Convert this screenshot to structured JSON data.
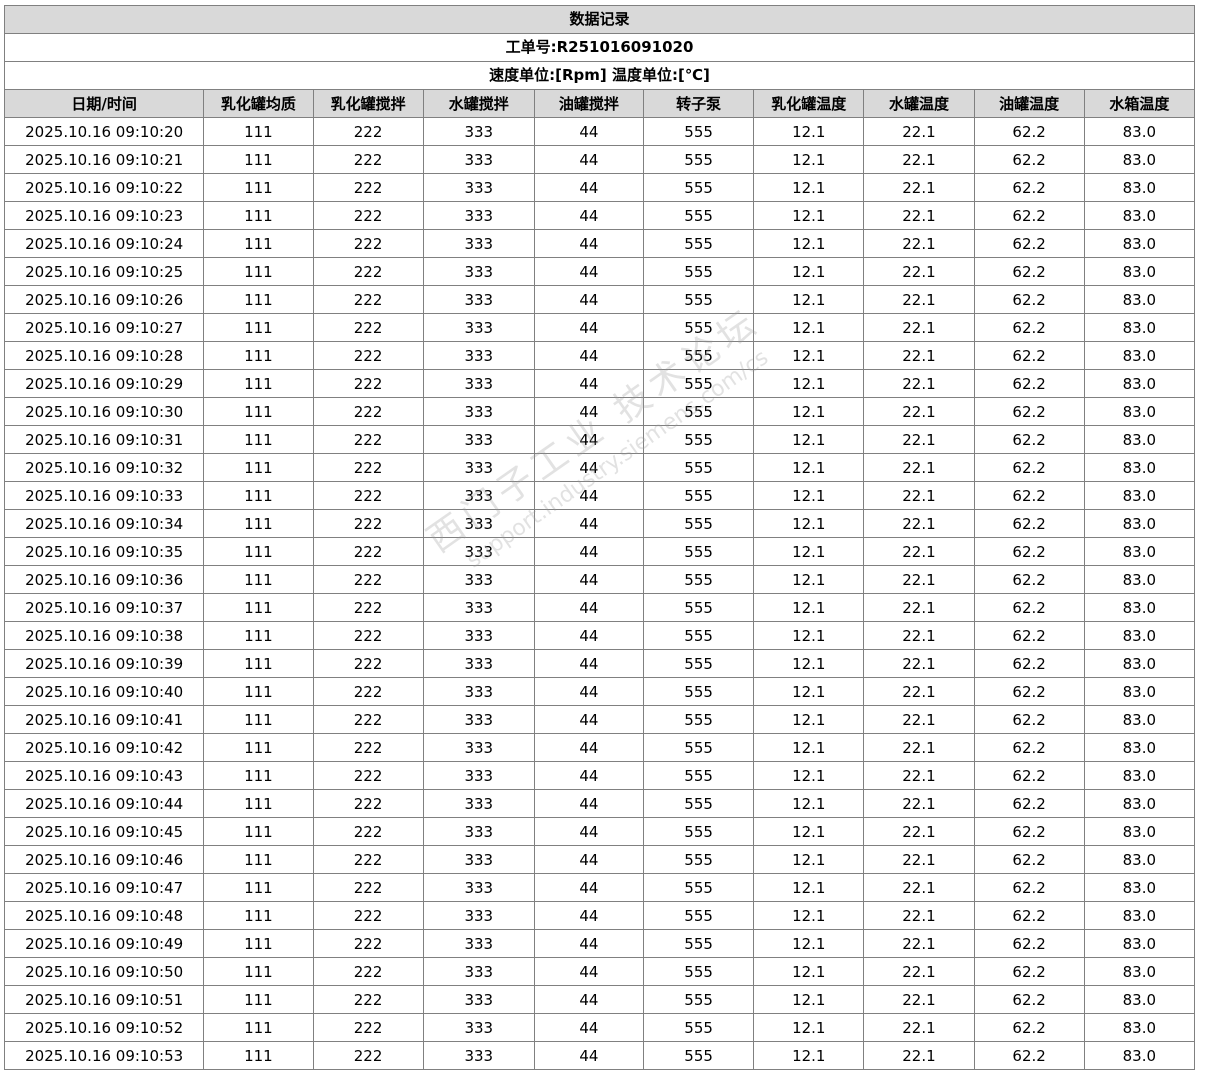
{
  "report": {
    "title": "数据记录",
    "order_label": "工单号:R251016091020",
    "units_label": "速度单位:[Rpm] 温度单位:[℃]"
  },
  "table": {
    "columns": [
      "日期/时间",
      "乳化罐均质",
      "乳化罐搅拌",
      "水罐搅拌",
      "油罐搅拌",
      "转子泵",
      "乳化罐温度",
      "水罐温度",
      "油罐温度",
      "水箱温度"
    ],
    "rows": [
      [
        "2025.10.16 09:10:20",
        "111",
        "222",
        "333",
        "44",
        "555",
        "12.1",
        "22.1",
        "62.2",
        "83.0"
      ],
      [
        "2025.10.16 09:10:21",
        "111",
        "222",
        "333",
        "44",
        "555",
        "12.1",
        "22.1",
        "62.2",
        "83.0"
      ],
      [
        "2025.10.16 09:10:22",
        "111",
        "222",
        "333",
        "44",
        "555",
        "12.1",
        "22.1",
        "62.2",
        "83.0"
      ],
      [
        "2025.10.16 09:10:23",
        "111",
        "222",
        "333",
        "44",
        "555",
        "12.1",
        "22.1",
        "62.2",
        "83.0"
      ],
      [
        "2025.10.16 09:10:24",
        "111",
        "222",
        "333",
        "44",
        "555",
        "12.1",
        "22.1",
        "62.2",
        "83.0"
      ],
      [
        "2025.10.16 09:10:25",
        "111",
        "222",
        "333",
        "44",
        "555",
        "12.1",
        "22.1",
        "62.2",
        "83.0"
      ],
      [
        "2025.10.16 09:10:26",
        "111",
        "222",
        "333",
        "44",
        "555",
        "12.1",
        "22.1",
        "62.2",
        "83.0"
      ],
      [
        "2025.10.16 09:10:27",
        "111",
        "222",
        "333",
        "44",
        "555",
        "12.1",
        "22.1",
        "62.2",
        "83.0"
      ],
      [
        "2025.10.16 09:10:28",
        "111",
        "222",
        "333",
        "44",
        "555",
        "12.1",
        "22.1",
        "62.2",
        "83.0"
      ],
      [
        "2025.10.16 09:10:29",
        "111",
        "222",
        "333",
        "44",
        "555",
        "12.1",
        "22.1",
        "62.2",
        "83.0"
      ],
      [
        "2025.10.16 09:10:30",
        "111",
        "222",
        "333",
        "44",
        "555",
        "12.1",
        "22.1",
        "62.2",
        "83.0"
      ],
      [
        "2025.10.16 09:10:31",
        "111",
        "222",
        "333",
        "44",
        "555",
        "12.1",
        "22.1",
        "62.2",
        "83.0"
      ],
      [
        "2025.10.16 09:10:32",
        "111",
        "222",
        "333",
        "44",
        "555",
        "12.1",
        "22.1",
        "62.2",
        "83.0"
      ],
      [
        "2025.10.16 09:10:33",
        "111",
        "222",
        "333",
        "44",
        "555",
        "12.1",
        "22.1",
        "62.2",
        "83.0"
      ],
      [
        "2025.10.16 09:10:34",
        "111",
        "222",
        "333",
        "44",
        "555",
        "12.1",
        "22.1",
        "62.2",
        "83.0"
      ],
      [
        "2025.10.16 09:10:35",
        "111",
        "222",
        "333",
        "44",
        "555",
        "12.1",
        "22.1",
        "62.2",
        "83.0"
      ],
      [
        "2025.10.16 09:10:36",
        "111",
        "222",
        "333",
        "44",
        "555",
        "12.1",
        "22.1",
        "62.2",
        "83.0"
      ],
      [
        "2025.10.16 09:10:37",
        "111",
        "222",
        "333",
        "44",
        "555",
        "12.1",
        "22.1",
        "62.2",
        "83.0"
      ],
      [
        "2025.10.16 09:10:38",
        "111",
        "222",
        "333",
        "44",
        "555",
        "12.1",
        "22.1",
        "62.2",
        "83.0"
      ],
      [
        "2025.10.16 09:10:39",
        "111",
        "222",
        "333",
        "44",
        "555",
        "12.1",
        "22.1",
        "62.2",
        "83.0"
      ],
      [
        "2025.10.16 09:10:40",
        "111",
        "222",
        "333",
        "44",
        "555",
        "12.1",
        "22.1",
        "62.2",
        "83.0"
      ],
      [
        "2025.10.16 09:10:41",
        "111",
        "222",
        "333",
        "44",
        "555",
        "12.1",
        "22.1",
        "62.2",
        "83.0"
      ],
      [
        "2025.10.16 09:10:42",
        "111",
        "222",
        "333",
        "44",
        "555",
        "12.1",
        "22.1",
        "62.2",
        "83.0"
      ],
      [
        "2025.10.16 09:10:43",
        "111",
        "222",
        "333",
        "44",
        "555",
        "12.1",
        "22.1",
        "62.2",
        "83.0"
      ],
      [
        "2025.10.16 09:10:44",
        "111",
        "222",
        "333",
        "44",
        "555",
        "12.1",
        "22.1",
        "62.2",
        "83.0"
      ],
      [
        "2025.10.16 09:10:45",
        "111",
        "222",
        "333",
        "44",
        "555",
        "12.1",
        "22.1",
        "62.2",
        "83.0"
      ],
      [
        "2025.10.16 09:10:46",
        "111",
        "222",
        "333",
        "44",
        "555",
        "12.1",
        "22.1",
        "62.2",
        "83.0"
      ],
      [
        "2025.10.16 09:10:47",
        "111",
        "222",
        "333",
        "44",
        "555",
        "12.1",
        "22.1",
        "62.2",
        "83.0"
      ],
      [
        "2025.10.16 09:10:48",
        "111",
        "222",
        "333",
        "44",
        "555",
        "12.1",
        "22.1",
        "62.2",
        "83.0"
      ],
      [
        "2025.10.16 09:10:49",
        "111",
        "222",
        "333",
        "44",
        "555",
        "12.1",
        "22.1",
        "62.2",
        "83.0"
      ],
      [
        "2025.10.16 09:10:50",
        "111",
        "222",
        "333",
        "44",
        "555",
        "12.1",
        "22.1",
        "62.2",
        "83.0"
      ],
      [
        "2025.10.16 09:10:51",
        "111",
        "222",
        "333",
        "44",
        "555",
        "12.1",
        "22.1",
        "62.2",
        "83.0"
      ],
      [
        "2025.10.16 09:10:52",
        "111",
        "222",
        "333",
        "44",
        "555",
        "12.1",
        "22.1",
        "62.2",
        "83.0"
      ],
      [
        "2025.10.16 09:10:53",
        "111",
        "222",
        "333",
        "44",
        "555",
        "12.1",
        "22.1",
        "62.2",
        "83.0"
      ]
    ]
  },
  "watermark": {
    "cn": "西门子工业 技术论坛",
    "en": "support.industry.siemens.com/cs"
  },
  "colors": {
    "header_bg": "#d9d9d9",
    "border": "#808080",
    "watermark": "#969696"
  }
}
